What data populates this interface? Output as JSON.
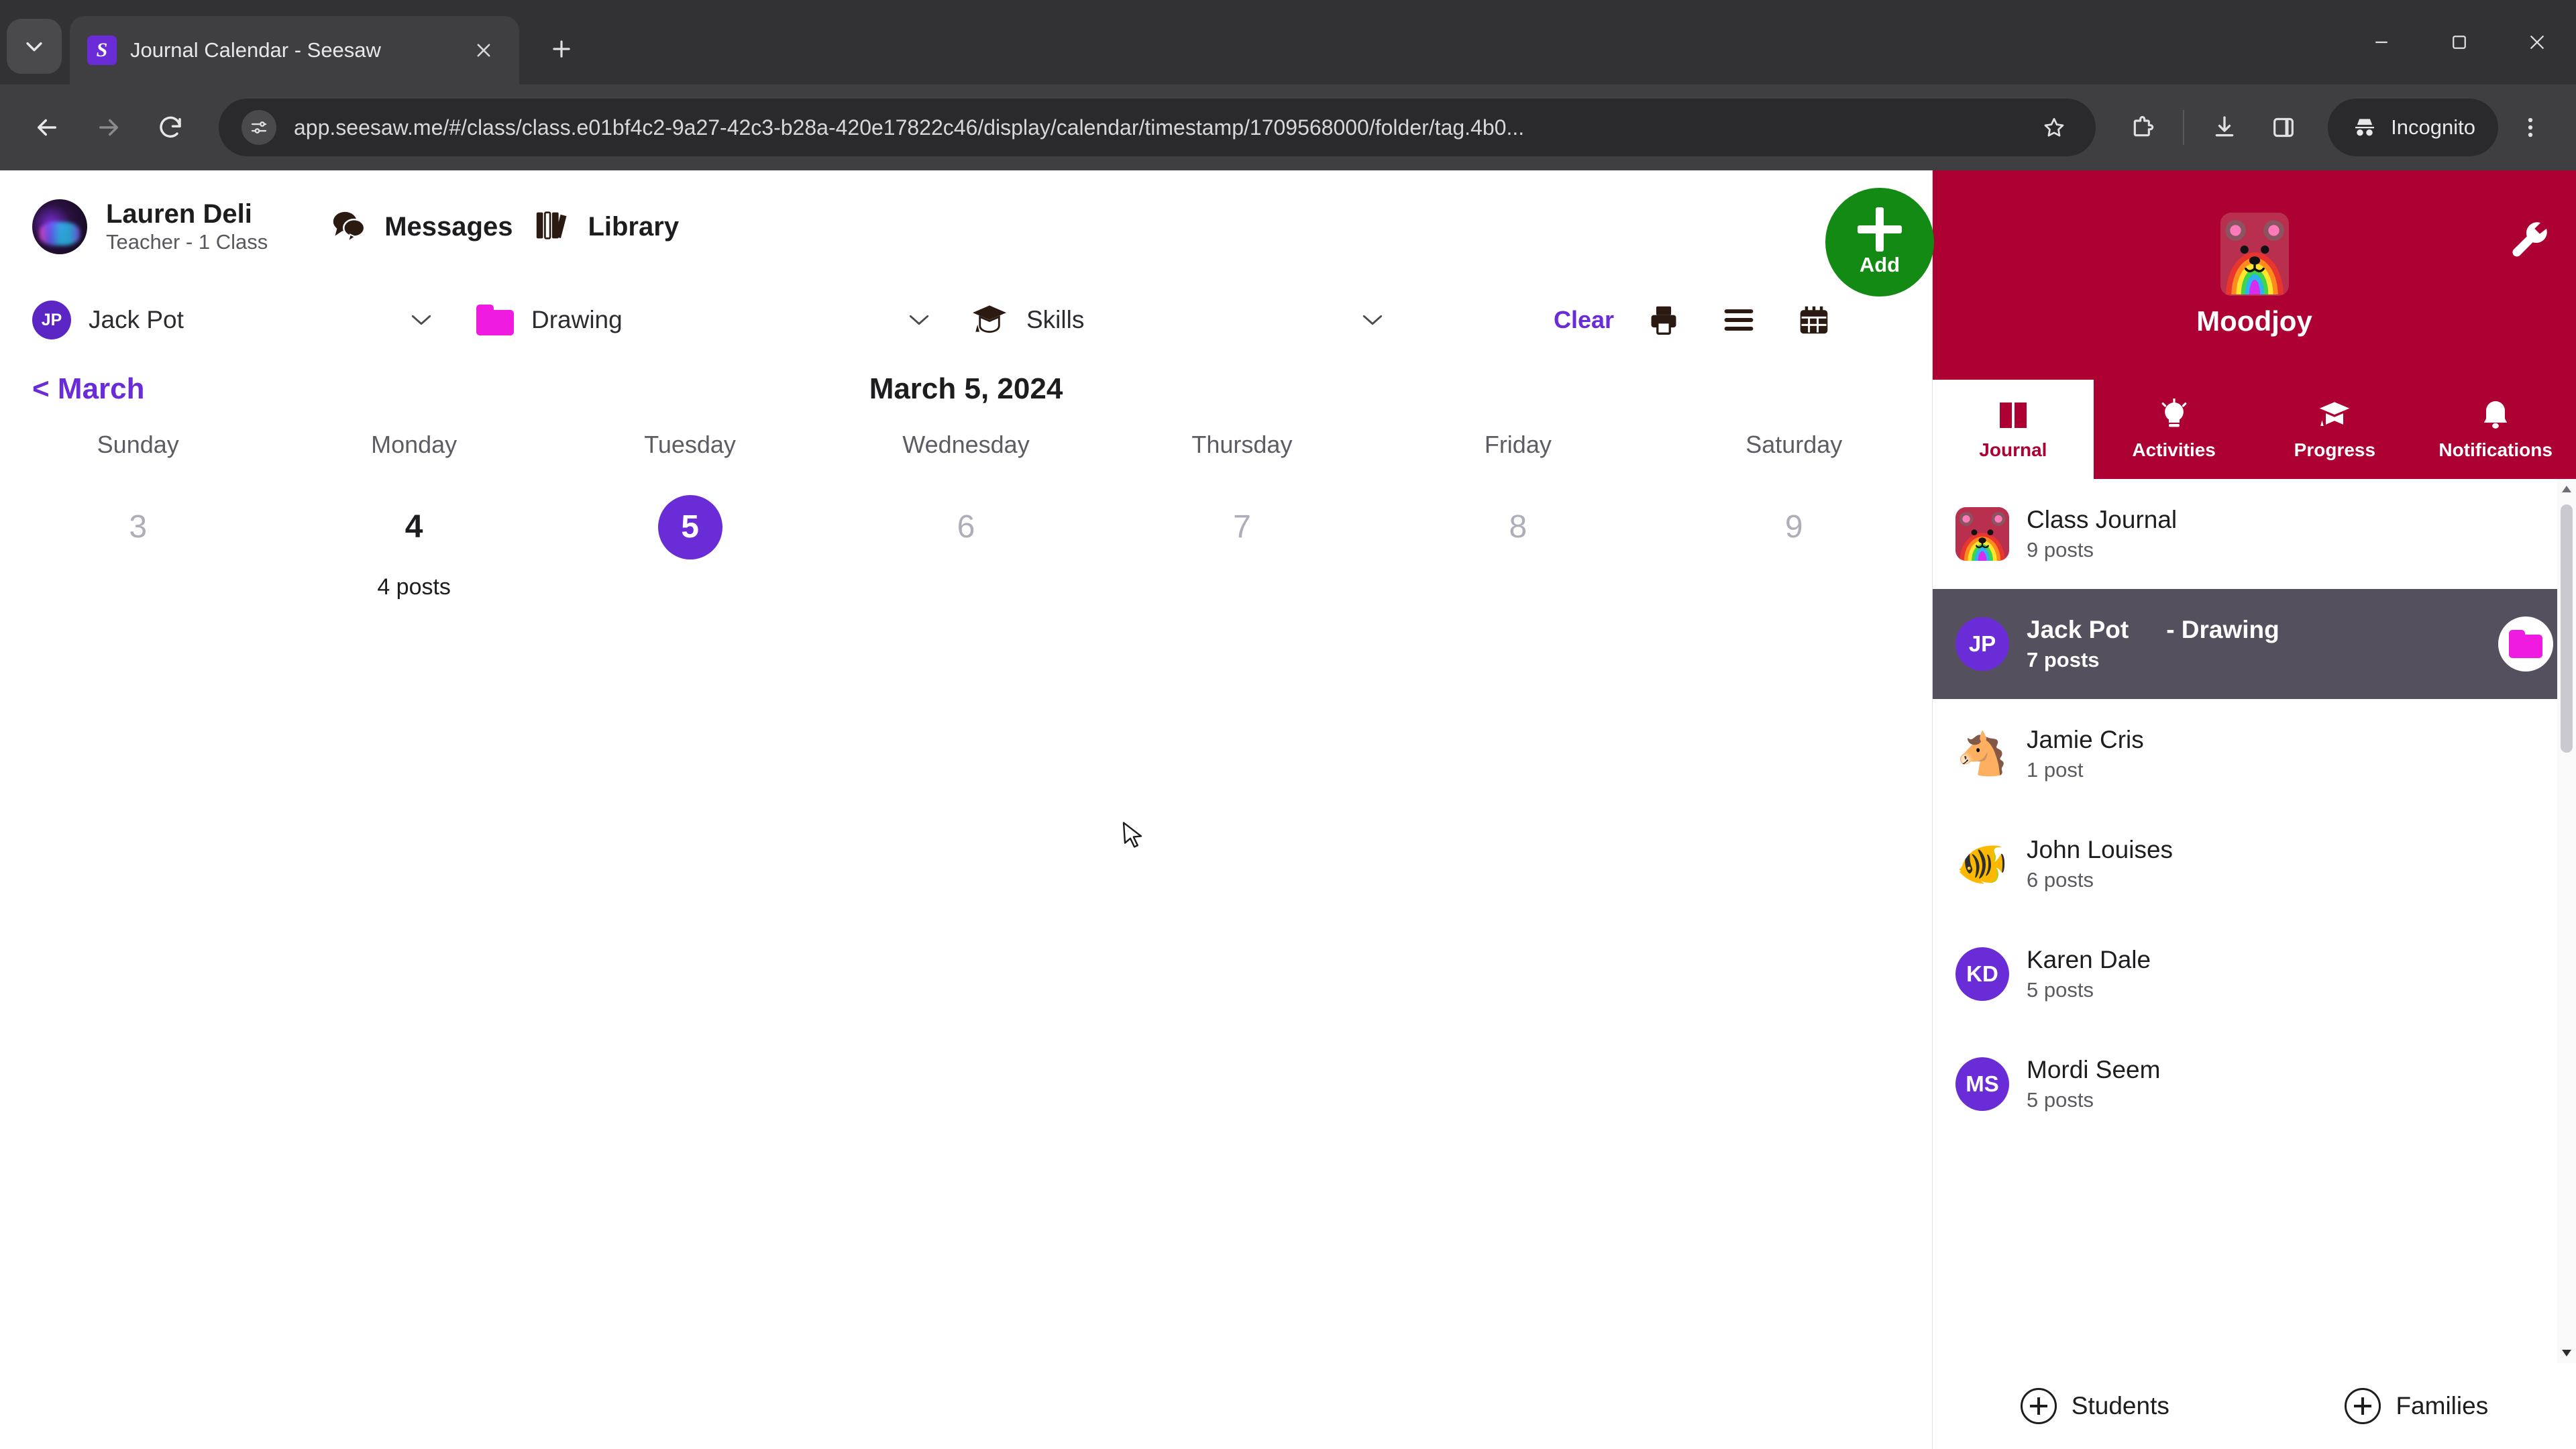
{
  "browser": {
    "tab": {
      "title": "Journal Calendar - Seesaw",
      "favicon_letter": "S"
    },
    "url": "app.seesaw.me/#/class/class.e01bf4c2-9a27-42c3-b28a-420e17822c46/display/calendar/timestamp/1709568000/folder/tag.4b0...",
    "profile_label": "Incognito",
    "icons": {
      "tab_list": "tab-list-icon",
      "new_tab": "new-tab-icon",
      "close_tab": "close-tab-icon",
      "back": "back-icon",
      "forward": "forward-icon",
      "reload": "reload-icon",
      "site_info": "site-settings-icon",
      "bookmark": "star-icon",
      "extensions": "extensions-icon",
      "downloads": "download-icon",
      "side_panel": "side-panel-icon",
      "incognito": "incognito-icon",
      "menu": "kebab-menu-icon",
      "minimize": "minimize-icon",
      "maximize": "maximize-icon",
      "window_close": "window-close-icon"
    }
  },
  "header": {
    "teacher_name": "Lauren Deli",
    "teacher_role": "Teacher - 1 Class",
    "nav": [
      {
        "label": "Messages",
        "icon": "messages-icon"
      },
      {
        "label": "Library",
        "icon": "library-icon"
      }
    ]
  },
  "filters": {
    "student": {
      "initials": "JP",
      "label": "Jack Pot"
    },
    "folder": {
      "label": "Drawing",
      "color": "#F01BE0"
    },
    "skills": {
      "label": "Skills",
      "icon": "graduation-cap-icon"
    },
    "clear_label": "Clear",
    "tools": [
      {
        "name": "print-icon"
      },
      {
        "name": "list-view-icon"
      },
      {
        "name": "calendar-view-icon"
      }
    ]
  },
  "calendar": {
    "prev_month_label": "< March",
    "selected_date_title": "March 5, 2024",
    "day_names": [
      "Sunday",
      "Monday",
      "Tuesday",
      "Wednesday",
      "Thursday",
      "Friday",
      "Saturday"
    ],
    "days": [
      {
        "number": "3",
        "posts": "",
        "state": "empty"
      },
      {
        "number": "4",
        "posts": "4 posts",
        "state": "has-posts"
      },
      {
        "number": "5",
        "posts": "",
        "state": "selected"
      },
      {
        "number": "6",
        "posts": "",
        "state": "empty"
      },
      {
        "number": "7",
        "posts": "",
        "state": "empty"
      },
      {
        "number": "8",
        "posts": "",
        "state": "empty"
      },
      {
        "number": "9",
        "posts": "",
        "state": "empty"
      }
    ]
  },
  "sidebar": {
    "add_label": "Add",
    "class_name": "Moodjoy",
    "settings_icon": "wrench-icon",
    "tabs": [
      {
        "label": "Journal",
        "icon": "journal-book-icon",
        "active": true
      },
      {
        "label": "Activities",
        "icon": "lightbulb-icon",
        "active": false
      },
      {
        "label": "Progress",
        "icon": "graduation-cap-icon",
        "active": false
      },
      {
        "label": "Notifications",
        "icon": "bell-icon",
        "active": false
      }
    ],
    "entries": [
      {
        "name": "Class Journal",
        "posts": "9 posts",
        "avatar_type": "rainbow-bear",
        "initials": "",
        "emoji": "",
        "selected": false,
        "tag": ""
      },
      {
        "name": "Jack Pot",
        "posts": "7 posts",
        "avatar_type": "initials",
        "initials": "JP",
        "emoji": "",
        "selected": true,
        "tag": "- Drawing"
      },
      {
        "name": "Jamie Cris",
        "posts": "1 post",
        "avatar_type": "emoji",
        "initials": "",
        "emoji": "🐴",
        "selected": false,
        "tag": ""
      },
      {
        "name": "John Louises",
        "posts": "6 posts",
        "avatar_type": "emoji",
        "initials": "",
        "emoji": "🐠",
        "selected": false,
        "tag": ""
      },
      {
        "name": "Karen Dale",
        "posts": "5 posts",
        "avatar_type": "initials",
        "initials": "KD",
        "emoji": "",
        "selected": false,
        "tag": ""
      },
      {
        "name": "Mordi Seem",
        "posts": "5 posts",
        "avatar_type": "initials",
        "initials": "MS",
        "emoji": "",
        "selected": false,
        "tag": ""
      }
    ],
    "footer": [
      {
        "label": "Students",
        "icon": "add-students-icon"
      },
      {
        "label": "Families",
        "icon": "add-families-icon"
      }
    ]
  },
  "colors": {
    "purple": "#6A2CD6",
    "crimson": "#AD0033",
    "green": "#138A13",
    "magenta": "#F01BE0",
    "selected_row": "#55505E"
  }
}
